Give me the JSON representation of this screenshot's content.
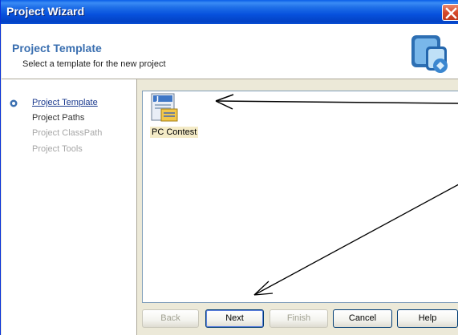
{
  "window": {
    "title": "Project Wizard"
  },
  "header": {
    "title": "Project Template",
    "subtitle": "Select a template for the new project"
  },
  "nav": {
    "items": [
      {
        "label": "Project Template",
        "state": "active"
      },
      {
        "label": "Project Paths",
        "state": "done"
      },
      {
        "label": "Project ClassPath",
        "state": "disabled"
      },
      {
        "label": "Project Tools",
        "state": "disabled"
      }
    ]
  },
  "templates": [
    {
      "label": "PC Contest",
      "icon": "java-template-icon",
      "selected": true
    }
  ],
  "buttons": {
    "back": "Back",
    "next": "Next",
    "finish": "Finish",
    "cancel": "Cancel",
    "help": "Help"
  },
  "colors": {
    "title_bar": "#0751dd",
    "close_button": "#d6492b",
    "header_title": "#3a6fb0"
  }
}
